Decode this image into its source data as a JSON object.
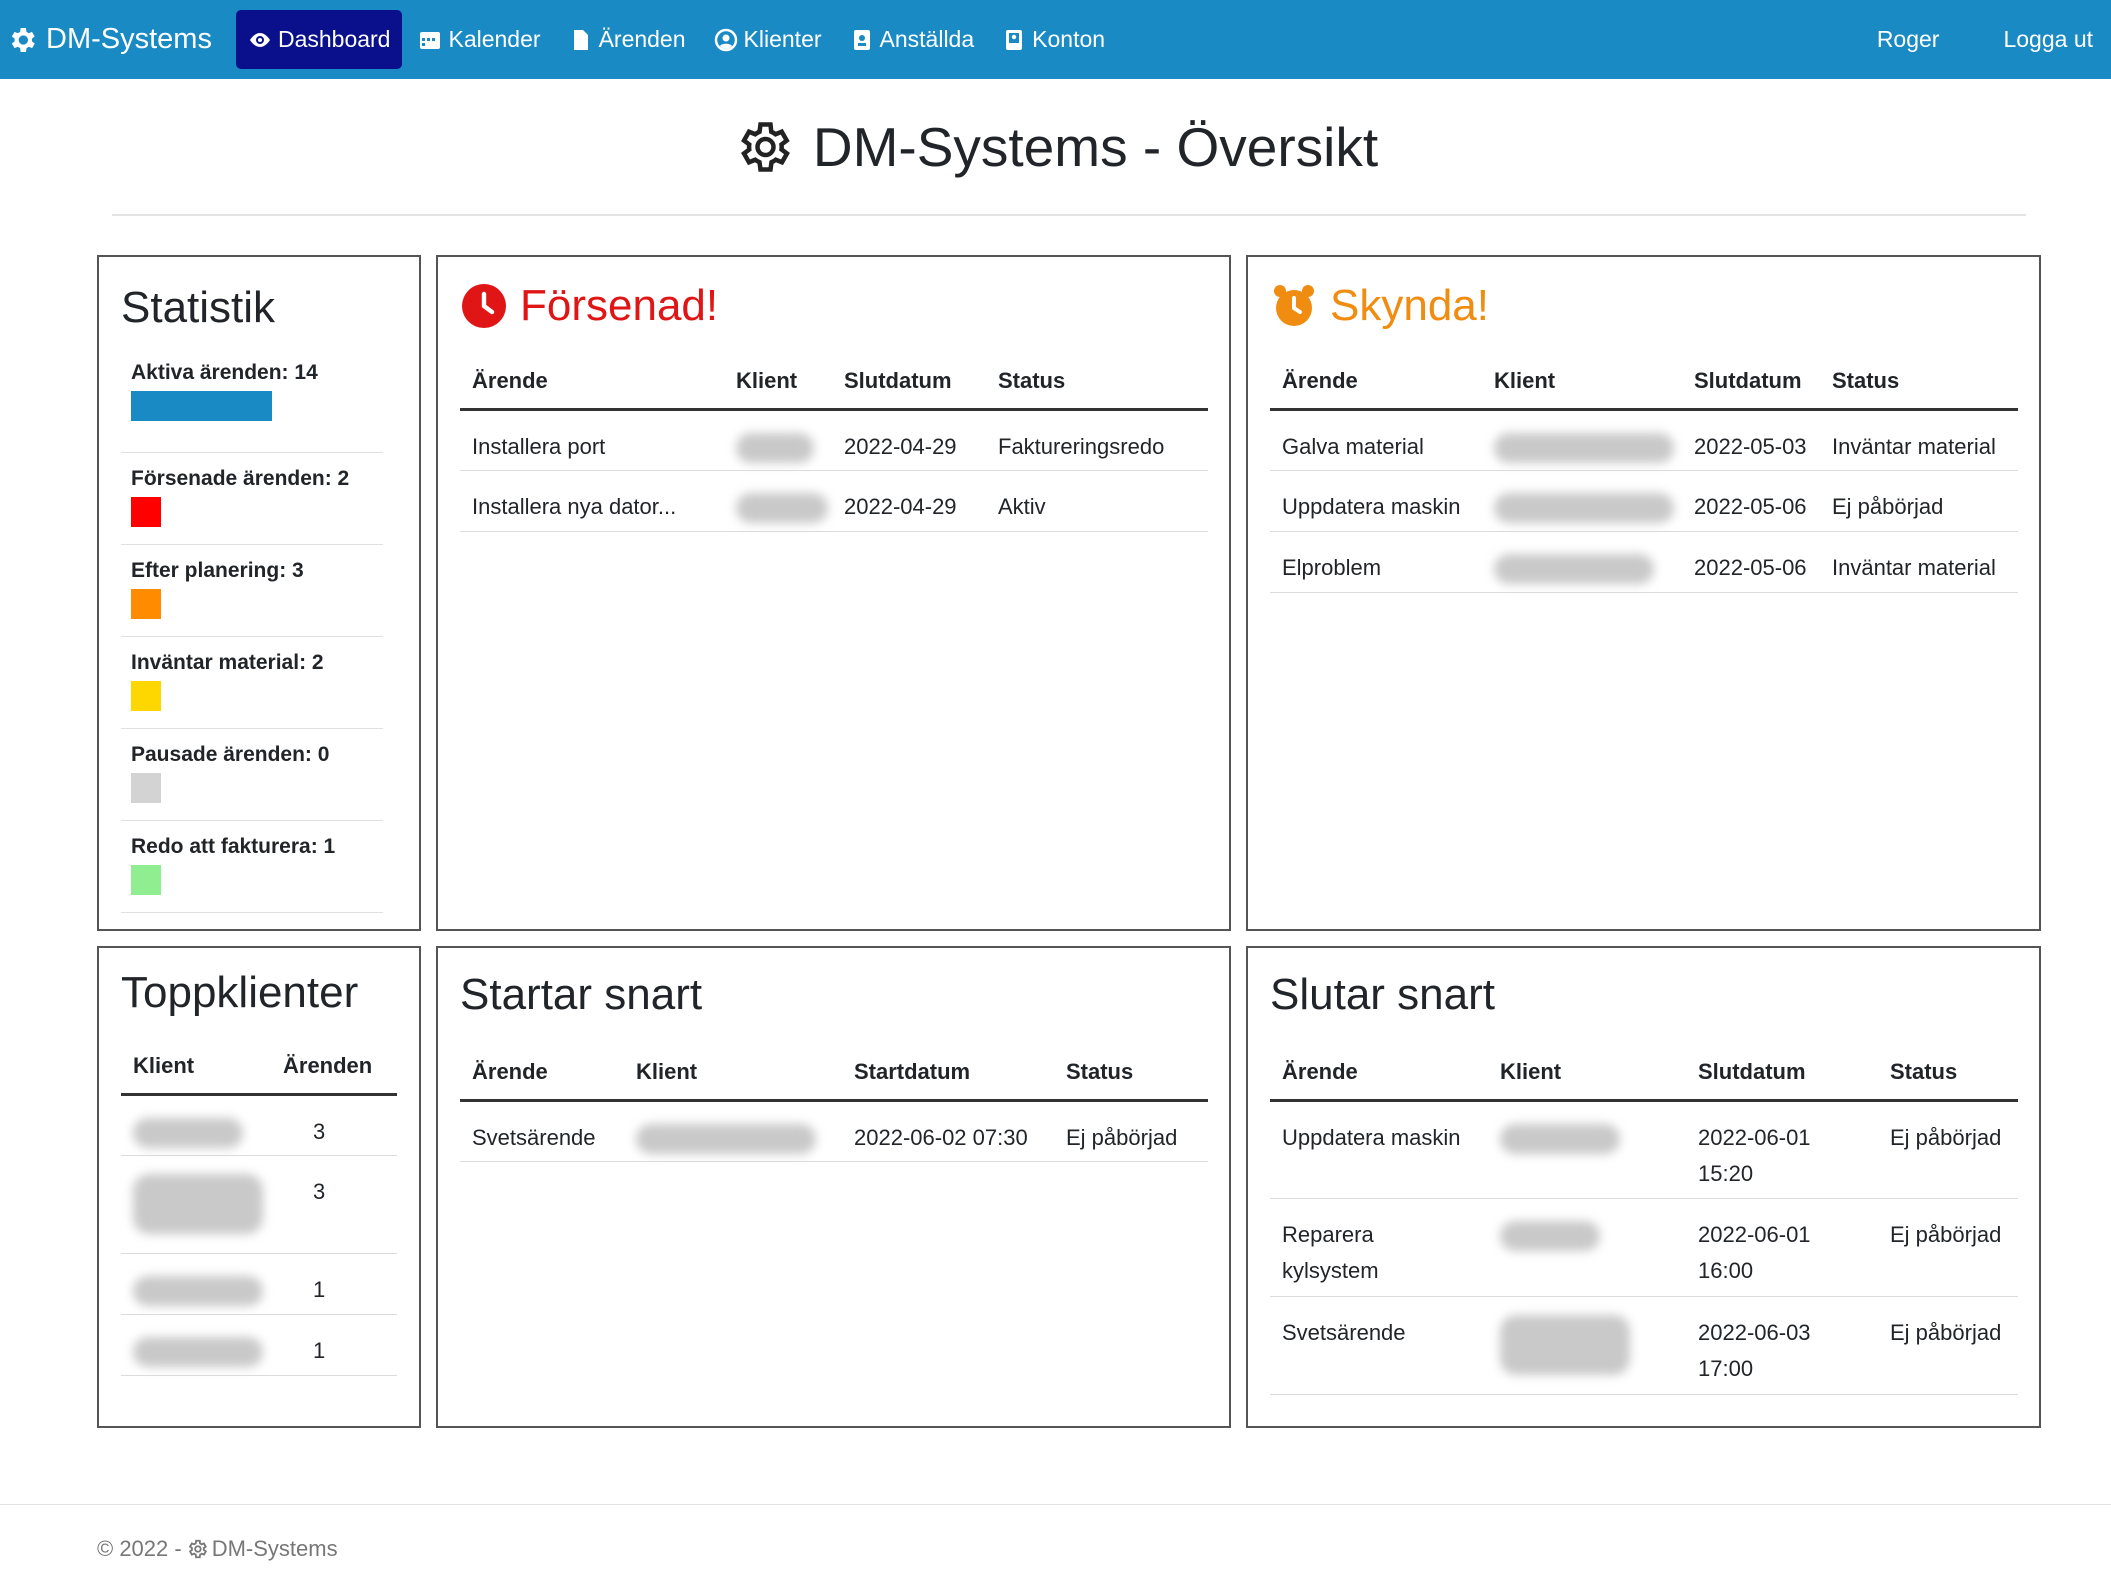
{
  "navbar": {
    "brand": "DM-Systems",
    "items": [
      {
        "label": "Dashboard",
        "icon": "eye-icon"
      },
      {
        "label": "Kalender",
        "icon": "calendar-icon"
      },
      {
        "label": "Ärenden",
        "icon": "file-icon"
      },
      {
        "label": "Klienter",
        "icon": "user-circle-icon"
      },
      {
        "label": "Anställda",
        "icon": "id-badge-icon"
      },
      {
        "label": "Konton",
        "icon": "account-icon"
      }
    ],
    "user": "Roger",
    "logout": "Logga ut",
    "color": "#1a8ac4",
    "active_color": "#0a0f8c"
  },
  "page": {
    "title": "DM-Systems - Översikt"
  },
  "statistik": {
    "title": "Statistik",
    "items": [
      {
        "label": "Aktiva ärenden: 14",
        "color": "#1a8ac4"
      },
      {
        "label": "Försenade ärenden: 2",
        "color": "#ff0000"
      },
      {
        "label": "Efter planering: 3",
        "color": "#ff8c00"
      },
      {
        "label": "Inväntar material: 2",
        "color": "#ffd700"
      },
      {
        "label": "Pausade ärenden: 0",
        "color": "#d3d3d3"
      },
      {
        "label": "Redo att fakturera: 1",
        "color": "#90ee90"
      }
    ]
  },
  "forsenad": {
    "title": "Försenad!",
    "headers": [
      "Ärende",
      "Klient",
      "Slutdatum",
      "Status"
    ],
    "rows": [
      {
        "arende": "Installera port",
        "slutdatum": "2022-04-29",
        "status": "Faktureringsredo"
      },
      {
        "arende": "Installera nya dator...",
        "slutdatum": "2022-04-29",
        "status": "Aktiv"
      }
    ]
  },
  "skynda": {
    "title": "Skynda!",
    "headers": [
      "Ärende",
      "Klient",
      "Slutdatum",
      "Status"
    ],
    "rows": [
      {
        "arende": "Galva material",
        "slutdatum": "2022-05-03",
        "status": "Inväntar material"
      },
      {
        "arende": "Uppdatera maskin",
        "slutdatum": "2022-05-06",
        "status": "Ej påbörjad"
      },
      {
        "arende": "Elproblem",
        "slutdatum": "2022-05-06",
        "status": "Inväntar material"
      }
    ]
  },
  "toppklienter": {
    "title": "Toppklienter",
    "headers": [
      "Klient",
      "Ärenden"
    ],
    "rows": [
      {
        "arenden": "3"
      },
      {
        "arenden": "3"
      },
      {
        "arenden": "1"
      },
      {
        "arenden": "1"
      }
    ]
  },
  "startar": {
    "title": "Startar snart",
    "headers": [
      "Ärende",
      "Klient",
      "Startdatum",
      "Status"
    ],
    "rows": [
      {
        "arende": "Svetsärende",
        "startdatum": "2022-06-02 07:30",
        "status": "Ej påbörjad"
      }
    ]
  },
  "slutar": {
    "title": "Slutar snart",
    "headers": [
      "Ärende",
      "Klient",
      "Slutdatum",
      "Status"
    ],
    "rows": [
      {
        "arende": "Uppdatera maskin",
        "slutdatum": "2022-06-01 15:20",
        "status": "Ej påbörjad"
      },
      {
        "arende": "Reparera kylsystem",
        "slutdatum": "2022-06-01 16:00",
        "status": "Ej påbörjad"
      },
      {
        "arende": "Svetsärende",
        "slutdatum": "2022-06-03 17:00",
        "status": "Ej påbörjad"
      }
    ]
  },
  "footer": {
    "copyright": "© 2022 -",
    "brand": "DM-Systems"
  }
}
